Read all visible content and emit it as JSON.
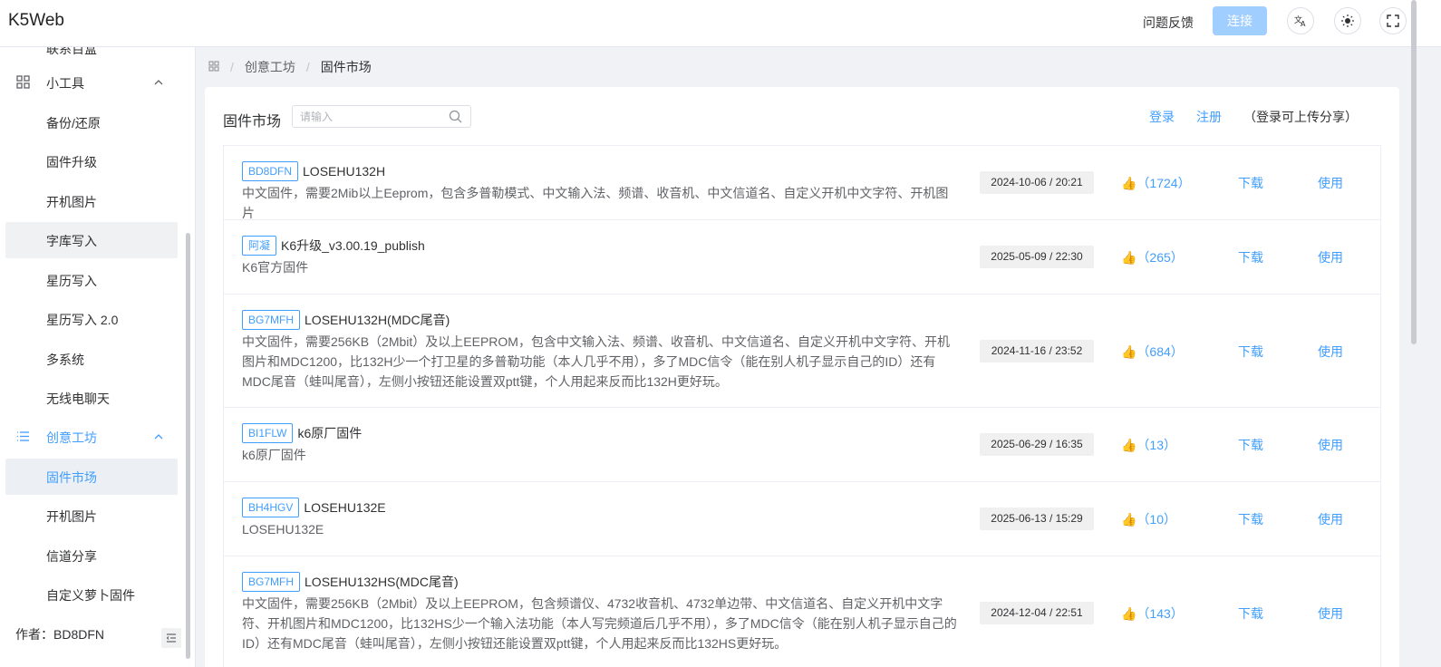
{
  "app": {
    "title": "K5Web"
  },
  "header": {
    "feedback_label": "问题反馈",
    "connect_label": "连接",
    "icons": [
      "translate-icon",
      "theme-sun-icon",
      "fullscreen-icon"
    ]
  },
  "sidebar": {
    "cutoff_label": "联系百盒",
    "group_tools": {
      "label": "小工具",
      "icon": "grid-icon"
    },
    "tools_items": [
      "备份/还原",
      "固件升级",
      "开机图片",
      "字库写入",
      "星历写入",
      "星历写入 2.0",
      "多系统",
      "无线电聊天"
    ],
    "group_workshop": {
      "label": "创意工坊",
      "icon": "list-icon"
    },
    "workshop_items": [
      "固件市场",
      "开机图片",
      "信道分享",
      "自定义萝卜固件"
    ],
    "author": "作者：BD8DFN"
  },
  "breadcrumb": {
    "items": [
      "创意工坊",
      "固件市场"
    ]
  },
  "market": {
    "title": "固件市场",
    "search_placeholder": "请输入",
    "login_label": "登录",
    "register_label": "注册",
    "note": "（登录可上传分享）",
    "download_label": "下载",
    "use_label": "使用",
    "rows": [
      {
        "tag": "BD8DFN",
        "name": "LOSEHU132H",
        "desc": "中文固件，需要2Mib以上Eeprom，包含多普勒模式、中文输入法、频谱、收音机、中文信道名、自定义开机中文字符、开机图片",
        "date": "2024-10-06 / 20:21",
        "likes": "👍（1724）"
      },
      {
        "tag": "阿凝",
        "name": "K6升级_v3.00.19_publish",
        "desc": "K6官方固件",
        "date": "2025-05-09 / 22:30",
        "likes": "👍（265）"
      },
      {
        "tag": "BG7MFH",
        "name": "LOSEHU132H(MDC尾音)",
        "desc": "中文固件，需要256KB（2Mbit）及以上EEPROM，包含中文输入法、频谱、收音机、中文信道名、自定义开机中文字符、开机图片和MDC1200，比132H少一个打卫星的多普勒功能（本人几乎不用），多了MDC信令（能在别人机子显示自己的ID）还有MDC尾音（蛙叫尾音），左侧小按钮还能设置双ptt键，个人用起来反而比132H更好玩。",
        "date": "2024-11-16 / 23:52",
        "likes": "👍（684）"
      },
      {
        "tag": "BI1FLW",
        "name": "k6原厂固件",
        "desc": "k6原厂固件",
        "date": "2025-06-29 / 16:35",
        "likes": "👍（13）"
      },
      {
        "tag": "BH4HGV",
        "name": "LOSEHU132E",
        "desc": "LOSEHU132E",
        "date": "2025-06-13 / 15:29",
        "likes": "👍（10）"
      },
      {
        "tag": "BG7MFH",
        "name": "LOSEHU132HS(MDC尾音)",
        "desc": "中文固件，需要256KB（2Mbit）及以上EEPROM，包含频谱仪、4732收音机、4732单边带、中文信道名、自定义开机中文字符、开机图片和MDC1200，比132HS少一个输入法功能（本人写完频道后几乎不用），多了MDC信令（能在别人机子显示自己的ID）还有MDC尾音（蛙叫尾音），左侧小按钮还能设置双ptt键，个人用起来反而比132HS更好玩。",
        "date": "2024-12-04 / 22:51",
        "likes": "👍（143）"
      }
    ]
  },
  "colors": {
    "accent": "#409eff",
    "connect_disabled": "#a0cfff",
    "active_bg": "#ecf0f5"
  }
}
